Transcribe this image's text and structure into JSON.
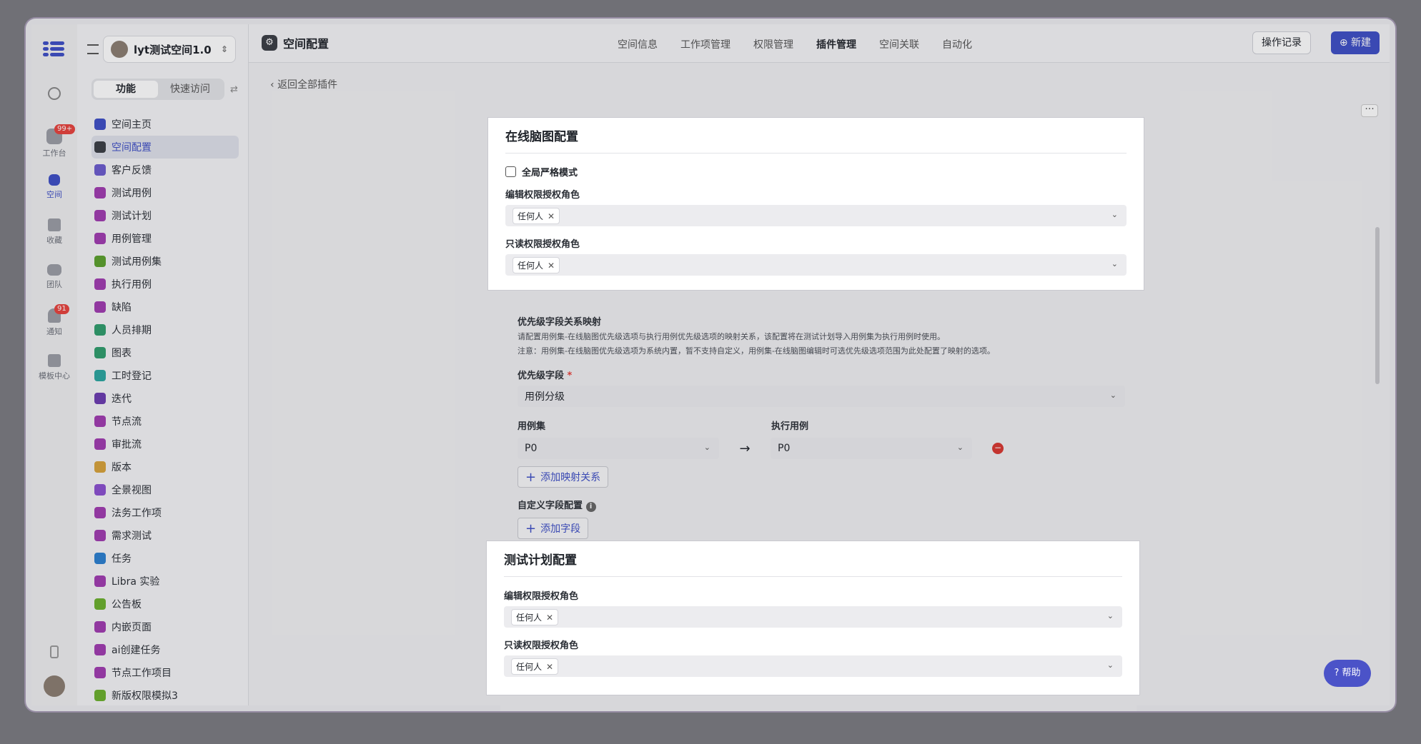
{
  "rail": {
    "items": [
      {
        "label": "工作台",
        "badge": "99+"
      },
      {
        "label": "空间"
      },
      {
        "label": "收藏"
      },
      {
        "label": "团队"
      },
      {
        "label": "通知",
        "badge": "91"
      },
      {
        "label": "模板中心"
      }
    ]
  },
  "sidebar": {
    "space_name": "lyt测试空间1.0",
    "seg_tabs": [
      "功能",
      "快速访问"
    ],
    "items": [
      {
        "label": "空间主页",
        "color": "#3d4ec5"
      },
      {
        "label": "空间配置",
        "color": "#3a3d44"
      },
      {
        "label": "客户反馈",
        "color": "#6a5acd"
      },
      {
        "label": "测试用例",
        "color": "#a03bb0"
      },
      {
        "label": "测试计划",
        "color": "#a03bb0"
      },
      {
        "label": "用例管理",
        "color": "#a03bb0"
      },
      {
        "label": "测试用例集",
        "color": "#5aa02c"
      },
      {
        "label": "执行用例",
        "color": "#a03bb0"
      },
      {
        "label": "缺陷",
        "color": "#a03bb0"
      },
      {
        "label": "人员排期",
        "color": "#2e9d6b"
      },
      {
        "label": "图表",
        "color": "#2e9d6b"
      },
      {
        "label": "工时登记",
        "color": "#2aa6a0"
      },
      {
        "label": "迭代",
        "color": "#6a3bb0"
      },
      {
        "label": "节点流",
        "color": "#a03bb0"
      },
      {
        "label": "审批流",
        "color": "#a03bb0"
      },
      {
        "label": "版本",
        "color": "#d8a23a"
      },
      {
        "label": "全景视图",
        "color": "#8a4fd0"
      },
      {
        "label": "法务工作项",
        "color": "#a03bb0"
      },
      {
        "label": "需求测试",
        "color": "#a03bb0"
      },
      {
        "label": "任务",
        "color": "#2a7fd0"
      },
      {
        "label": "Libra 实验",
        "color": "#a03bb0"
      },
      {
        "label": "公告板",
        "color": "#6ab02c"
      },
      {
        "label": "内嵌页面",
        "color": "#a03bb0"
      },
      {
        "label": "ai创建任务",
        "color": "#a03bb0"
      },
      {
        "label": "节点工作项目",
        "color": "#a03bb0"
      },
      {
        "label": "新版权限模拟3",
        "color": "#6ab02c"
      }
    ]
  },
  "header": {
    "title": "空间配置",
    "tabs": [
      "空间信息",
      "工作项管理",
      "权限管理",
      "插件管理",
      "空间关联",
      "自动化"
    ],
    "active_tab": "插件管理",
    "log_button": "操作记录",
    "new_button": "新建"
  },
  "content": {
    "back_link": "返回全部插件",
    "mindmap": {
      "title": "在线脑图配置",
      "strict_mode": "全局严格模式",
      "edit_role_label": "编辑权限授权角色",
      "read_role_label": "只读权限授权角色",
      "tag": "任何人"
    },
    "priority": {
      "title": "优先级字段关系映射",
      "desc1": "请配置用例集-在线脑图优先级选项与执行用例优先级选项的映射关系，该配置将在测试计划导入用例集为执行用例时使用。",
      "desc2": "注意：用例集-在线脑图优先级选项为系统内置，暂不支持自定义，用例集-在线脑图编辑时可选优先级选项范围为此处配置了映射的选项。",
      "field_label": "优先级字段",
      "field_value": "用例分级",
      "col_left": "用例集",
      "col_right": "执行用例",
      "left_value": "P0",
      "right_value": "P0",
      "add_mapping": "添加映射关系"
    },
    "custom": {
      "title": "自定义字段配置",
      "add_field": "添加字段"
    },
    "testplan": {
      "title": "测试计划配置",
      "edit_role_label": "编辑权限授权角色",
      "read_role_label": "只读权限授权角色",
      "tag": "任何人"
    }
  },
  "help_button": "帮助"
}
